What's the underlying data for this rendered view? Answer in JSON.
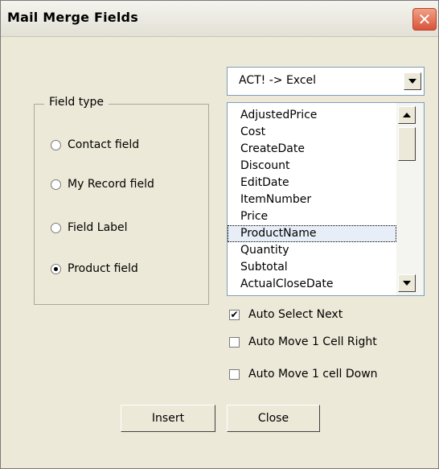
{
  "window": {
    "title": "Mail Merge Fields",
    "close_label": "✕"
  },
  "mapping": {
    "selected": "ACT! -> Excel"
  },
  "field_type": {
    "label": "Field type",
    "options": [
      {
        "label": "Contact field",
        "checked": false
      },
      {
        "label": "My Record field",
        "checked": false
      },
      {
        "label": "Field Label",
        "checked": false
      },
      {
        "label": "Product field",
        "checked": true
      }
    ]
  },
  "fields_list": {
    "items": [
      "AdjustedPrice",
      "Cost",
      "CreateDate",
      "Discount",
      "EditDate",
      "ItemNumber",
      "Price",
      "ProductName",
      "Quantity",
      "Subtotal",
      "ActualCloseDate"
    ],
    "selected": "ProductName"
  },
  "options": [
    {
      "label": "Auto Select Next",
      "checked": true,
      "mark": "✔"
    },
    {
      "label": "Auto Move 1 Cell Right",
      "checked": false,
      "mark": ""
    },
    {
      "label": "Auto Move 1 cell Down",
      "checked": false,
      "mark": ""
    }
  ],
  "buttons": {
    "insert": "Insert",
    "close": "Close"
  }
}
